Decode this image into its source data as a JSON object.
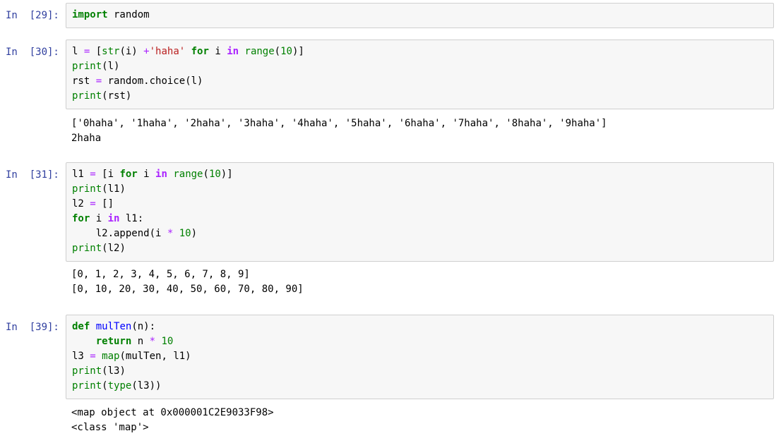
{
  "cells": [
    {
      "prompt": "In  [29]:",
      "code": [
        [
          [
            "kw",
            "import"
          ],
          [
            "nm",
            " random"
          ]
        ]
      ],
      "output": []
    },
    {
      "prompt": "In  [30]:",
      "code": [
        [
          [
            "nm",
            "l "
          ],
          [
            "op",
            "="
          ],
          [
            "nm",
            " ["
          ],
          [
            "bi",
            "str"
          ],
          [
            "nm",
            "(i) "
          ],
          [
            "op",
            "+"
          ],
          [
            "str",
            "'haha'"
          ],
          [
            "nm",
            " "
          ],
          [
            "kw",
            "for"
          ],
          [
            "nm",
            " i "
          ],
          [
            "opb",
            "in"
          ],
          [
            "nm",
            " "
          ],
          [
            "bi",
            "range"
          ],
          [
            "nm",
            "("
          ],
          [
            "num",
            "10"
          ],
          [
            "nm",
            ")]"
          ]
        ],
        [
          [
            "bi",
            "print"
          ],
          [
            "nm",
            "(l)"
          ]
        ],
        [
          [
            "nm",
            "rst "
          ],
          [
            "op",
            "="
          ],
          [
            "nm",
            " random.choice(l)"
          ]
        ],
        [
          [
            "bi",
            "print"
          ],
          [
            "nm",
            "(rst)"
          ]
        ]
      ],
      "output": [
        "['0haha', '1haha', '2haha', '3haha', '4haha', '5haha', '6haha', '7haha', '8haha', '9haha']",
        "2haha"
      ]
    },
    {
      "prompt": "In  [31]:",
      "code": [
        [
          [
            "nm",
            "l1 "
          ],
          [
            "op",
            "="
          ],
          [
            "nm",
            " [i "
          ],
          [
            "kw",
            "for"
          ],
          [
            "nm",
            " i "
          ],
          [
            "opb",
            "in"
          ],
          [
            "nm",
            " "
          ],
          [
            "bi",
            "range"
          ],
          [
            "nm",
            "("
          ],
          [
            "num",
            "10"
          ],
          [
            "nm",
            ")]"
          ]
        ],
        [
          [
            "bi",
            "print"
          ],
          [
            "nm",
            "(l1)"
          ]
        ],
        [
          [
            "nm",
            "l2 "
          ],
          [
            "op",
            "="
          ],
          [
            "nm",
            " []"
          ]
        ],
        [
          [
            "kw",
            "for"
          ],
          [
            "nm",
            " i "
          ],
          [
            "opb",
            "in"
          ],
          [
            "nm",
            " l1:"
          ]
        ],
        [
          [
            "nm",
            "    l2.append(i "
          ],
          [
            "op",
            "*"
          ],
          [
            "nm",
            " "
          ],
          [
            "num",
            "10"
          ],
          [
            "nm",
            ")"
          ]
        ],
        [
          [
            "bi",
            "print"
          ],
          [
            "nm",
            "(l2)"
          ]
        ]
      ],
      "output": [
        "[0, 1, 2, 3, 4, 5, 6, 7, 8, 9]",
        "[0, 10, 20, 30, 40, 50, 60, 70, 80, 90]"
      ]
    },
    {
      "prompt": "In  [39]:",
      "code": [
        [
          [
            "kw",
            "def"
          ],
          [
            "nm",
            " "
          ],
          [
            "fn",
            "mulTen"
          ],
          [
            "nm",
            "(n):"
          ]
        ],
        [
          [
            "nm",
            "    "
          ],
          [
            "kw",
            "return"
          ],
          [
            "nm",
            " n "
          ],
          [
            "op",
            "*"
          ],
          [
            "nm",
            " "
          ],
          [
            "num",
            "10"
          ]
        ],
        [
          [
            "nm",
            "l3 "
          ],
          [
            "op",
            "="
          ],
          [
            "nm",
            " "
          ],
          [
            "bi",
            "map"
          ],
          [
            "nm",
            "(mulTen, l1)"
          ]
        ],
        [
          [
            "bi",
            "print"
          ],
          [
            "nm",
            "(l3)"
          ]
        ],
        [
          [
            "bi",
            "print"
          ],
          [
            "nm",
            "("
          ],
          [
            "bi",
            "type"
          ],
          [
            "nm",
            "(l3))"
          ]
        ]
      ],
      "output": [
        "<map object at 0x000001C2E9033F98>",
        "<class 'map'>"
      ]
    }
  ]
}
